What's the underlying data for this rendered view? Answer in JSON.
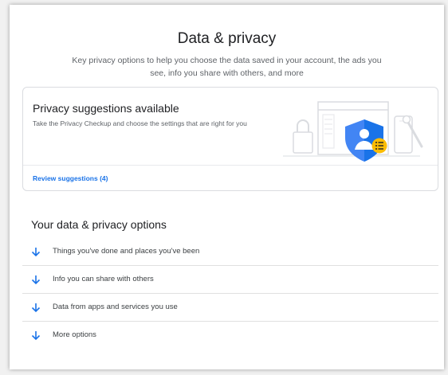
{
  "header": {
    "title": "Data & privacy",
    "subtitle": "Key privacy options to help you choose the data saved in your account, the ads you see, info you share with others, and more"
  },
  "privacy_card": {
    "title": "Privacy suggestions available",
    "description": "Take the Privacy Checkup and choose the settings that are right for you",
    "link_label": "Review suggestions (4)",
    "illustration_icon": "shield-person-icon"
  },
  "options_section": {
    "title": "Your data & privacy options",
    "items": [
      {
        "label": "Things you've done and places you've been",
        "icon": "arrow-down-icon"
      },
      {
        "label": "Info you can share with others",
        "icon": "arrow-down-icon"
      },
      {
        "label": "Data from apps and services you use",
        "icon": "arrow-down-icon"
      },
      {
        "label": "More options",
        "icon": "arrow-down-icon"
      }
    ]
  },
  "colors": {
    "accent": "#1a73e8",
    "shield_blue": "#4285f4",
    "badge_yellow": "#fbbc04",
    "divider": "#e0e0e0"
  }
}
